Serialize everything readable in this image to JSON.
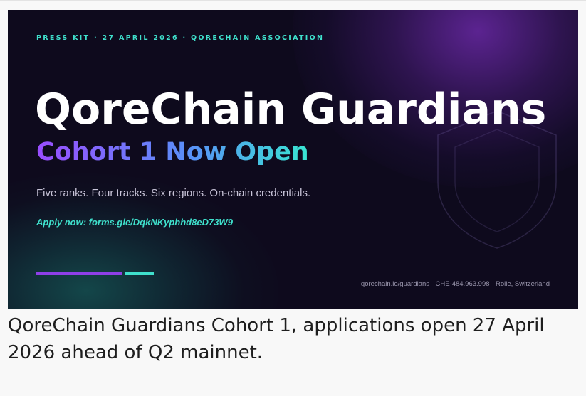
{
  "banner": {
    "kicker": "PRESS KIT · 27 APRIL 2026 · QORECHAIN ASSOCIATION",
    "title": "QoreChain Guardians",
    "subtitle": "Cohort 1 Now Open",
    "tagline": "Five ranks. Four tracks. Six regions. On-chain credentials.",
    "apply": "Apply now: forms.gle/DqkNKyphhd8eD73W9",
    "footer": "qorechain.io/guardians · CHE-484.963.998 · Rolle, Switzerland",
    "shield_icon": "shield-icon",
    "colors": {
      "background": "#0e0a1d",
      "accent_teal": "#3fe0cc",
      "accent_purple": "#8e3fe8",
      "gradient_mid": "#5a8ef8",
      "title": "#ffffff"
    }
  },
  "caption": "QoreChain Guardians Cohort 1, applications open 27 April 2026 ahead of Q2 mainnet."
}
